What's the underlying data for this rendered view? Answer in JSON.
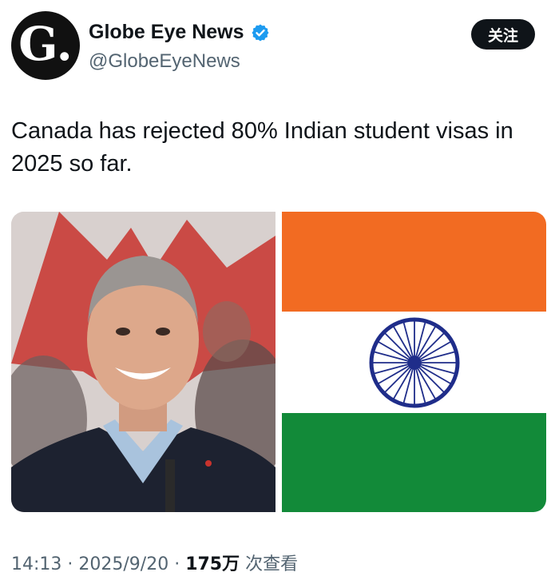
{
  "author": {
    "display_name": "Globe Eye News",
    "handle": "@GlobeEyeNews",
    "avatar_letter": "G."
  },
  "follow_label": "关注",
  "tweet": {
    "text": "Canada has rejected 80% Indian student visas in 2025 so far."
  },
  "media": {
    "left_description_icon": "photo-of-smiling-man-with-maple-leaf-backdrop",
    "right_description_icon": "flag-of-india"
  },
  "meta": {
    "time": "14:13",
    "sep1": " · ",
    "date": "2025/9/20",
    "sep2": " · ",
    "views_count": "175万",
    "views_label": " 次查看"
  },
  "colors": {
    "verified_blue": "#1d9bf0",
    "saffron": "#f26b22",
    "green": "#128a39",
    "chakra_blue": "#1f2d8a"
  }
}
